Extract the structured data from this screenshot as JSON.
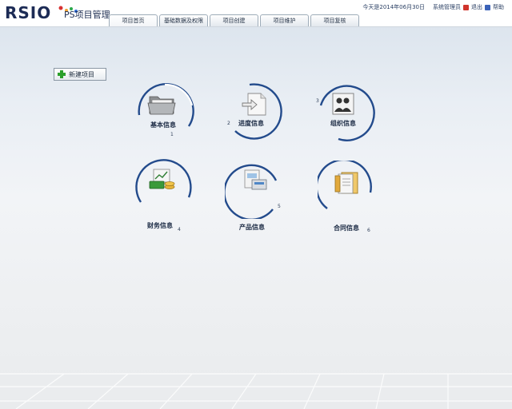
{
  "brand": {
    "logo_text": "RSIO",
    "app_title": "PS项目管理"
  },
  "nav": {
    "tabs": [
      {
        "label": "项目首页"
      },
      {
        "label": "基础数据及权限"
      },
      {
        "label": "项目创建"
      },
      {
        "label": "项目维护"
      },
      {
        "label": "项目复核"
      }
    ]
  },
  "topbar": {
    "date_text": "今天是2014年06月30日",
    "user": "系统管理员",
    "logout": "退出",
    "help": "帮助",
    "colors": {
      "logout": "#d0342c",
      "help": "#3a62b8"
    }
  },
  "main": {
    "new_project_button": "新建项目",
    "modules": [
      {
        "label": "基本信息",
        "number": "1",
        "icon": "folder-icon"
      },
      {
        "label": "进度信息",
        "number": "2",
        "icon": "document-arrow-icon"
      },
      {
        "label": "组织信息",
        "number": "3",
        "icon": "people-icon"
      },
      {
        "label": "财务信息",
        "number": "4",
        "icon": "money-chart-icon"
      },
      {
        "label": "产品信息",
        "number": "5",
        "icon": "product-icon"
      },
      {
        "label": "合同信息",
        "number": "6",
        "icon": "contract-binder-icon"
      }
    ]
  },
  "colors": {
    "accent": "#1f3f7a",
    "arc": "#234b8c"
  }
}
